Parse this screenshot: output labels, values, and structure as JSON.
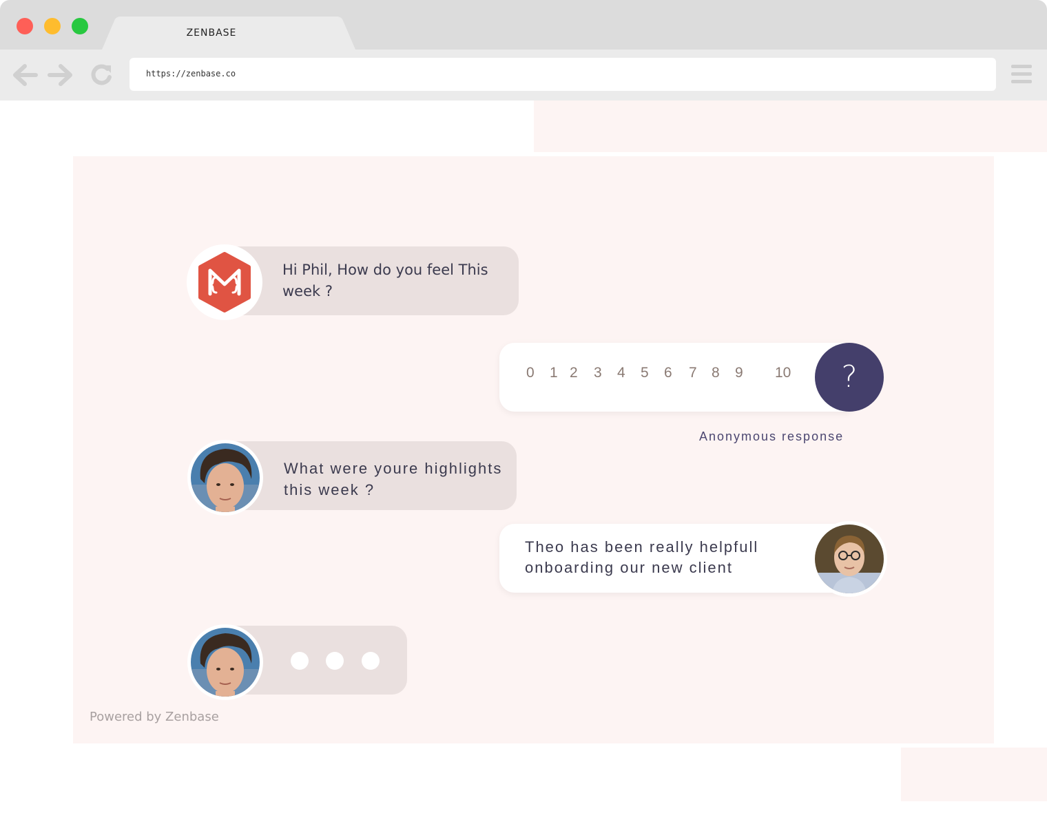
{
  "browser": {
    "tab_title": "ZENBASE",
    "url": "https://zenbase.co",
    "icons": {
      "back": "arrow-left-icon",
      "forward": "arrow-right-icon",
      "reload": "reload-icon",
      "menu": "hamburger-menu-icon"
    }
  },
  "colors": {
    "page_bg": "#fdf4f3",
    "bubble_bg": "#eae0df",
    "accent": "#443f6b",
    "logo": "#e05443"
  },
  "chat": {
    "bot_message": "Hi Phil, How do you feel This week ?",
    "scale": [
      "0",
      "1",
      "2",
      "3",
      "4",
      "5",
      "6",
      "7",
      "8",
      "9",
      "10"
    ],
    "question_symbol": "?",
    "anonymous_label": "Anonymous response",
    "question_message": "What were youre highlights this week ?",
    "reply_message_line1": "Theo has been really helpfull",
    "reply_message_line2": "onboarding our new client"
  },
  "footer": {
    "powered_by": "Powered by Zenbase"
  }
}
